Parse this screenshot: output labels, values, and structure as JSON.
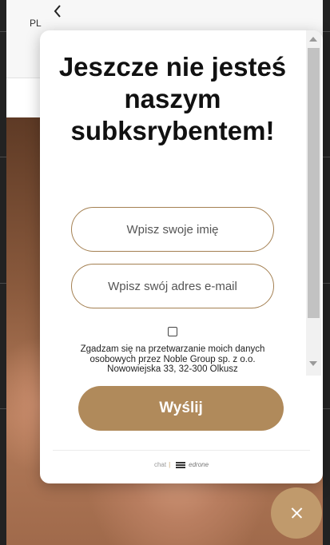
{
  "site": {
    "lang_label": "PL",
    "back_icon": "chevron-left-icon"
  },
  "popup": {
    "title": "Jeszcze nie jesteś naszym subksrybentem!",
    "name_placeholder": "Wpisz swoje imię",
    "email_placeholder": "Wpisz swój adres e-mail",
    "consent_text": "Zgadzam się na przetwarzanie moich danych osobowych przez Noble Group sp. z o.o. Nowowiejska 33, 32-300 Olkusz",
    "submit_label": "Wyślij",
    "footer_chat": "chat",
    "footer_brand": "edrone"
  },
  "fab": {
    "icon": "close-icon"
  },
  "colors": {
    "accent": "#b08a5b",
    "fab": "#c09a6c",
    "field_border": "#a48052"
  }
}
